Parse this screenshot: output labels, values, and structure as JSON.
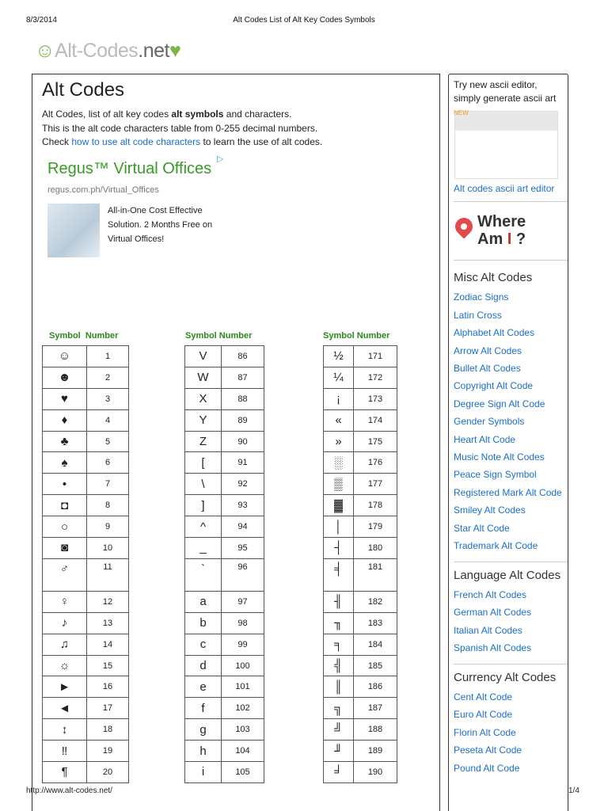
{
  "print_header": {
    "date": "8/3/2014",
    "title": "Alt Codes List of Alt Key Codes Symbols"
  },
  "print_footer": {
    "url": "http://www.alt-codes.net/",
    "page": "1/4"
  },
  "logo": {
    "smiley": "☺",
    "text1": "Alt-Codes",
    "text2": ".net",
    "heart": "♥"
  },
  "main": {
    "title": "Alt Codes",
    "intro1_pre": "Alt Codes, list of alt key codes ",
    "intro1_bold": "alt symbols",
    "intro1_post": " and characters.",
    "intro2": "This is the alt code characters table from 0-255 decimal numbers.",
    "intro3_pre": "Check ",
    "intro3_link": "how to use alt code characters",
    "intro3_post": " to learn the use of alt codes."
  },
  "ad": {
    "title": "Regus™ Virtual Offices",
    "badge": "▷",
    "url": "regus.com.ph/Virtual_Offices",
    "text": "All-in-One Cost Effective Solution. 2 Months Free on Virtual Offices!"
  },
  "table_header": {
    "symbol": "Symbol",
    "number": "Number"
  },
  "tables": [
    [
      [
        "☺",
        "1"
      ],
      [
        "☻",
        "2"
      ],
      [
        "♥",
        "3"
      ],
      [
        "♦",
        "4"
      ],
      [
        "♣",
        "5"
      ],
      [
        "♠",
        "6"
      ],
      [
        "•",
        "7"
      ],
      [
        "◘",
        "8"
      ],
      [
        "○",
        "9"
      ],
      [
        "◙",
        "10"
      ],
      [
        "♂",
        "11"
      ],
      [
        "♀",
        "12"
      ],
      [
        "♪",
        "13"
      ],
      [
        "♫",
        "14"
      ],
      [
        "☼",
        "15"
      ],
      [
        "►",
        "16"
      ],
      [
        "◄",
        "17"
      ],
      [
        "↕",
        "18"
      ],
      [
        "‼",
        "19"
      ],
      [
        "¶",
        "20"
      ]
    ],
    [
      [
        "V",
        "86"
      ],
      [
        "W",
        "87"
      ],
      [
        "X",
        "88"
      ],
      [
        "Y",
        "89"
      ],
      [
        "Z",
        "90"
      ],
      [
        "[",
        "91"
      ],
      [
        "\\",
        "92"
      ],
      [
        "]",
        "93"
      ],
      [
        "^",
        "94"
      ],
      [
        "_",
        "95"
      ],
      [
        "`",
        "96"
      ],
      [
        "a",
        "97"
      ],
      [
        "b",
        "98"
      ],
      [
        "c",
        "99"
      ],
      [
        "d",
        "100"
      ],
      [
        "e",
        "101"
      ],
      [
        "f",
        "102"
      ],
      [
        "g",
        "103"
      ],
      [
        "h",
        "104"
      ],
      [
        "i",
        "105"
      ]
    ],
    [
      [
        "½",
        "171"
      ],
      [
        "¼",
        "172"
      ],
      [
        "¡",
        "173"
      ],
      [
        "«",
        "174"
      ],
      [
        "»",
        "175"
      ],
      [
        "░",
        "176"
      ],
      [
        "▒",
        "177"
      ],
      [
        "▓",
        "178"
      ],
      [
        "│",
        "179"
      ],
      [
        "┤",
        "180"
      ],
      [
        "╡",
        "181"
      ],
      [
        "╢",
        "182"
      ],
      [
        "╖",
        "183"
      ],
      [
        "╕",
        "184"
      ],
      [
        "╣",
        "185"
      ],
      [
        "║",
        "186"
      ],
      [
        "╗",
        "187"
      ],
      [
        "╝",
        "188"
      ],
      [
        "╜",
        "189"
      ],
      [
        "╛",
        "190"
      ]
    ]
  ],
  "sidebar": {
    "promo_text": "Try new ascii editor, simply generate ascii art",
    "promo_badge": "NEW",
    "promo_link": "Alt codes ascii art editor",
    "where_am_i": {
      "line1": "Where",
      "line2a": "Am ",
      "line2b": "I",
      "line2c": " ?"
    },
    "sections": [
      {
        "title": "Misc Alt Codes",
        "links": [
          "Zodiac Signs",
          "Latin Cross",
          "Alphabet Alt Codes",
          "Arrow Alt Codes",
          "Bullet Alt Codes",
          "Copyright Alt Code",
          "Degree Sign Alt Code",
          "Gender Symbols",
          "Heart Alt Code",
          "Music Note Alt Codes",
          "Peace Sign Symbol",
          "Registered Mark Alt Code",
          "Smiley Alt Codes",
          "Star Alt Code",
          "Trademark Alt Code"
        ]
      },
      {
        "title": "Language Alt Codes",
        "links": [
          "French Alt Codes",
          "German Alt Codes",
          "Italian Alt Codes",
          "Spanish Alt Codes"
        ]
      },
      {
        "title": "Currency Alt Codes",
        "links": [
          "Cent Alt Code",
          "Euro Alt Code",
          "Florin Alt Code",
          "Peseta Alt Code",
          "Pound Alt Code"
        ]
      }
    ]
  }
}
